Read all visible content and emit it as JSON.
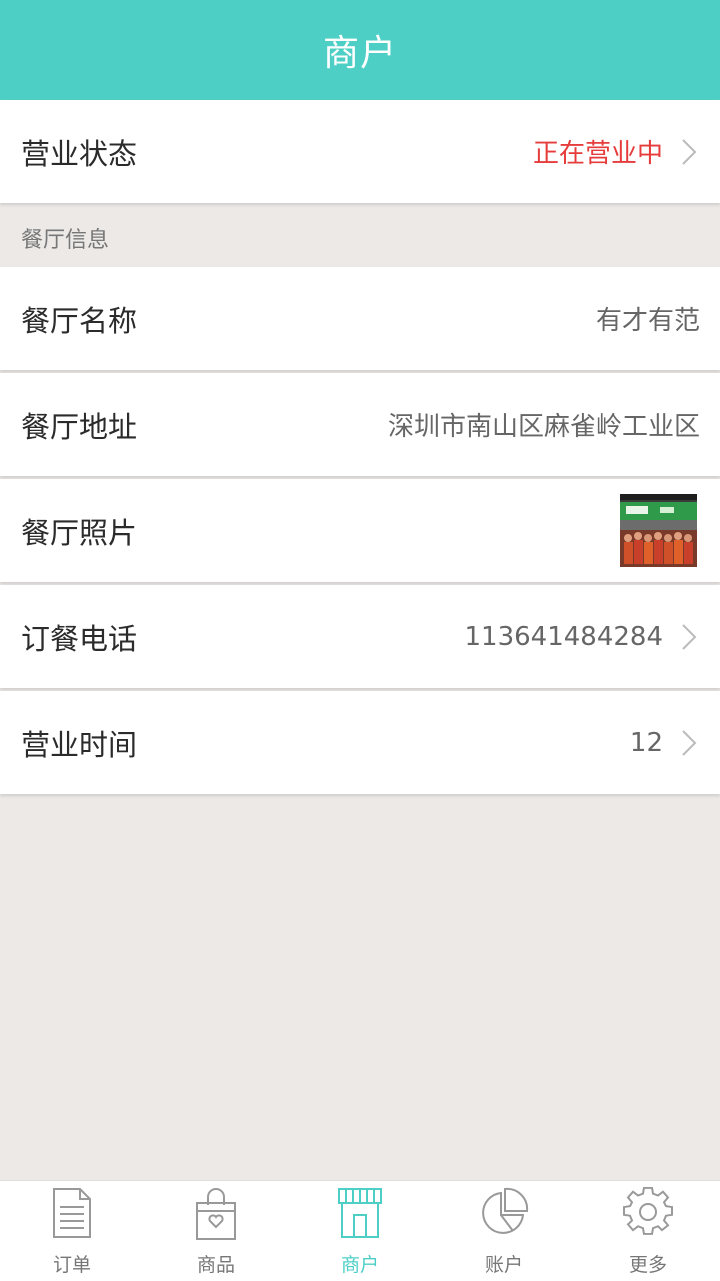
{
  "header": {
    "title": "商户"
  },
  "business_status": {
    "label": "营业状态",
    "value": "正在营业中",
    "value_color": "#E63C3C"
  },
  "restaurant_section": {
    "title": "餐厅信息",
    "name": {
      "label": "餐厅名称",
      "value": "有才有范"
    },
    "address": {
      "label": "餐厅地址",
      "value": "深圳市南山区麻雀岭工业区"
    },
    "photo": {
      "label": "餐厅照片"
    },
    "phone": {
      "label": "订餐电话",
      "value": "113641484284"
    },
    "hours": {
      "label": "营业时间",
      "value": "12"
    }
  },
  "tabbar": {
    "items": [
      {
        "label": "订单",
        "icon": "document-icon"
      },
      {
        "label": "商品",
        "icon": "shopping-bag-icon"
      },
      {
        "label": "商户",
        "icon": "storefront-icon",
        "active": true
      },
      {
        "label": "账户",
        "icon": "pie-chart-icon"
      },
      {
        "label": "更多",
        "icon": "gear-icon"
      }
    ],
    "active_color": "#4ECFC6"
  },
  "colors": {
    "brand": "#4ECFC6",
    "background": "#ECE9E7"
  }
}
